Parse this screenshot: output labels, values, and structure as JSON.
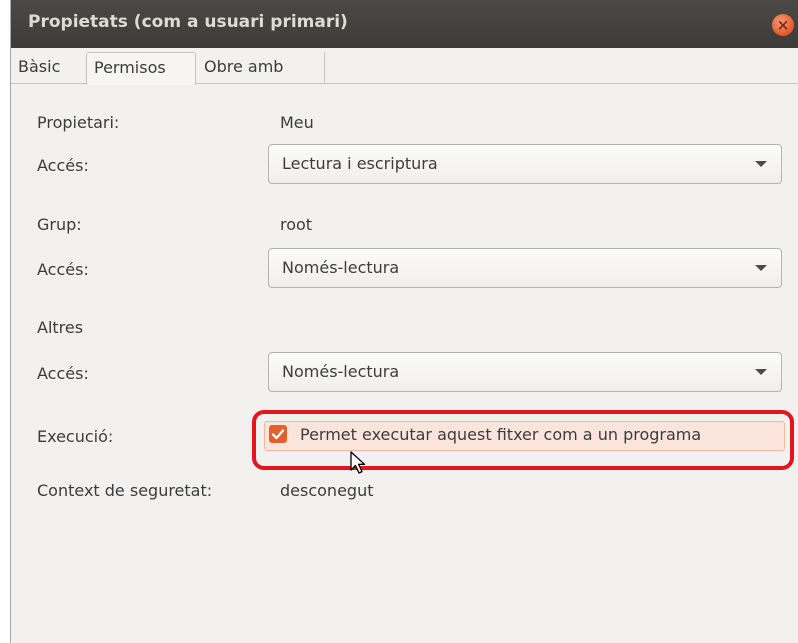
{
  "window": {
    "title": "Propietats (com a usuari primari)"
  },
  "tabs": [
    {
      "label": "Bàsic",
      "active": false
    },
    {
      "label": "Permisos",
      "active": true
    },
    {
      "label": "Obre amb",
      "active": false
    }
  ],
  "owner": {
    "label": "Propietari:",
    "value": "Meu",
    "access_label": "Accés:",
    "access_value": "Lectura i escriptura"
  },
  "group": {
    "label": "Grup:",
    "value": "root",
    "access_label": "Accés:",
    "access_value": "Només-lectura"
  },
  "others": {
    "label": "Altres",
    "access_label": "Accés:",
    "access_value": "Només-lectura"
  },
  "execution": {
    "label": "Execució:",
    "checkbox_label": "Permet executar aquest fitxer com a un programa",
    "checked": true
  },
  "security": {
    "label": "Context de seguretat:",
    "value": "desconegut"
  },
  "colors": {
    "accent": "#e1602c",
    "highlight": "#e3151e",
    "titlebar": "#3c3b37"
  }
}
